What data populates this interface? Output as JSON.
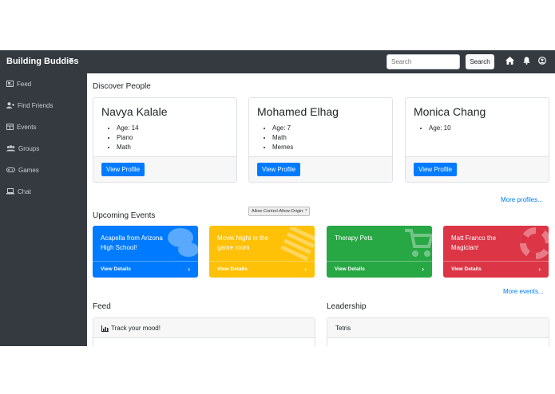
{
  "navbar": {
    "brand": "Building Buddies",
    "search_placeholder": "Search",
    "search_button": "Search",
    "icons": [
      "menu-icon",
      "home-icon",
      "bell-icon",
      "user-icon"
    ]
  },
  "sidebar": {
    "items": [
      {
        "label": "Feed",
        "icon": "feed-icon"
      },
      {
        "label": "Find Friends",
        "icon": "user-plus-icon"
      },
      {
        "label": "Events",
        "icon": "calendar-icon"
      },
      {
        "label": "Groups",
        "icon": "users-icon"
      },
      {
        "label": "Games",
        "icon": "gamepad-icon"
      },
      {
        "label": "Chat",
        "icon": "laptop-icon"
      }
    ]
  },
  "discover": {
    "title": "Discover People",
    "people": [
      {
        "name": "Navya Kalale",
        "details": [
          "Age: 14",
          "Piano",
          "Math"
        ],
        "button": "View Profile"
      },
      {
        "name": "Mohamed Elhag",
        "details": [
          "Age: 7",
          "Math",
          "Memes"
        ],
        "button": "View Profile"
      },
      {
        "name": "Monica Chang",
        "details": [
          "Age: 10"
        ],
        "button": "View Profile"
      }
    ],
    "more_link": "More profiles..."
  },
  "tooltip": "Allow-Control-Allow-Origin: *",
  "events": {
    "title": "Upcoming Events",
    "cards": [
      {
        "title": "Acapella from Arizona High School!",
        "action": "View Details",
        "color": "#007bff",
        "icon": "speech-bubbles-icon"
      },
      {
        "title": "Movie Night in the game room",
        "action": "View Details",
        "color": "#ffc107",
        "icon": "film-strip-icon"
      },
      {
        "title": "Therapy Pets",
        "action": "View Details",
        "color": "#28a745",
        "icon": "shopping-cart-icon"
      },
      {
        "title": "Matt Franco the Magician!",
        "action": "View Details",
        "color": "#dc3545",
        "icon": "life-ring-icon"
      }
    ],
    "more_link": "More events..."
  },
  "feed": {
    "title": "Feed",
    "card_header": "Track your mood!"
  },
  "leadership": {
    "title": "Leadership",
    "card_header": "Tetris"
  }
}
